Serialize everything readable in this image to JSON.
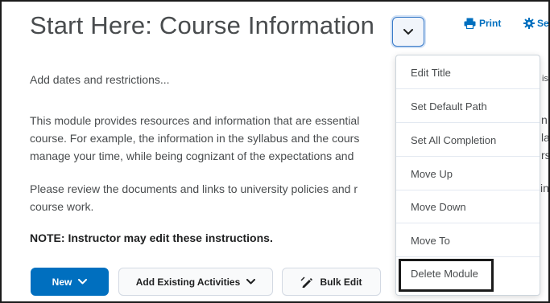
{
  "module": {
    "title": "Start Here: Course Information",
    "add_dates": "Add dates and restrictions...",
    "paragraph1": [
      "This module provides resources and information that are essential",
      "course. For example, the information in the syllabus and the cours",
      "manage your time, while being cognizant of the expectations and"
    ],
    "paragraph2": [
      "Please review the documents and links to university policies and r",
      "course work."
    ],
    "note": "NOTE: Instructor may edit these instructions.",
    "right_fragments": [
      "isl",
      "n",
      "la",
      "rs",
      "in"
    ]
  },
  "header_actions": {
    "print_label": "Print",
    "settings_label": "Se"
  },
  "toolbar": {
    "new_label": "New",
    "add_existing_label": "Add Existing Activities",
    "bulk_edit_label": "Bulk Edit"
  },
  "context_menu": {
    "items": [
      "Edit Title",
      "Set Default Path",
      "Set All Completion",
      "Move Up",
      "Move Down",
      "Move To",
      "Delete Module"
    ]
  },
  "colors": {
    "accent": "#006fbf",
    "text": "#494c4e",
    "highlight_border": "#1a1a1a"
  },
  "icons": {
    "title_toggle": "chevron-down-icon",
    "print": "printer-icon",
    "settings": "gear-icon",
    "new_chevron": "chevron-down-icon",
    "add_chevron": "chevron-down-icon",
    "bulk_edit": "pencil-icon"
  }
}
